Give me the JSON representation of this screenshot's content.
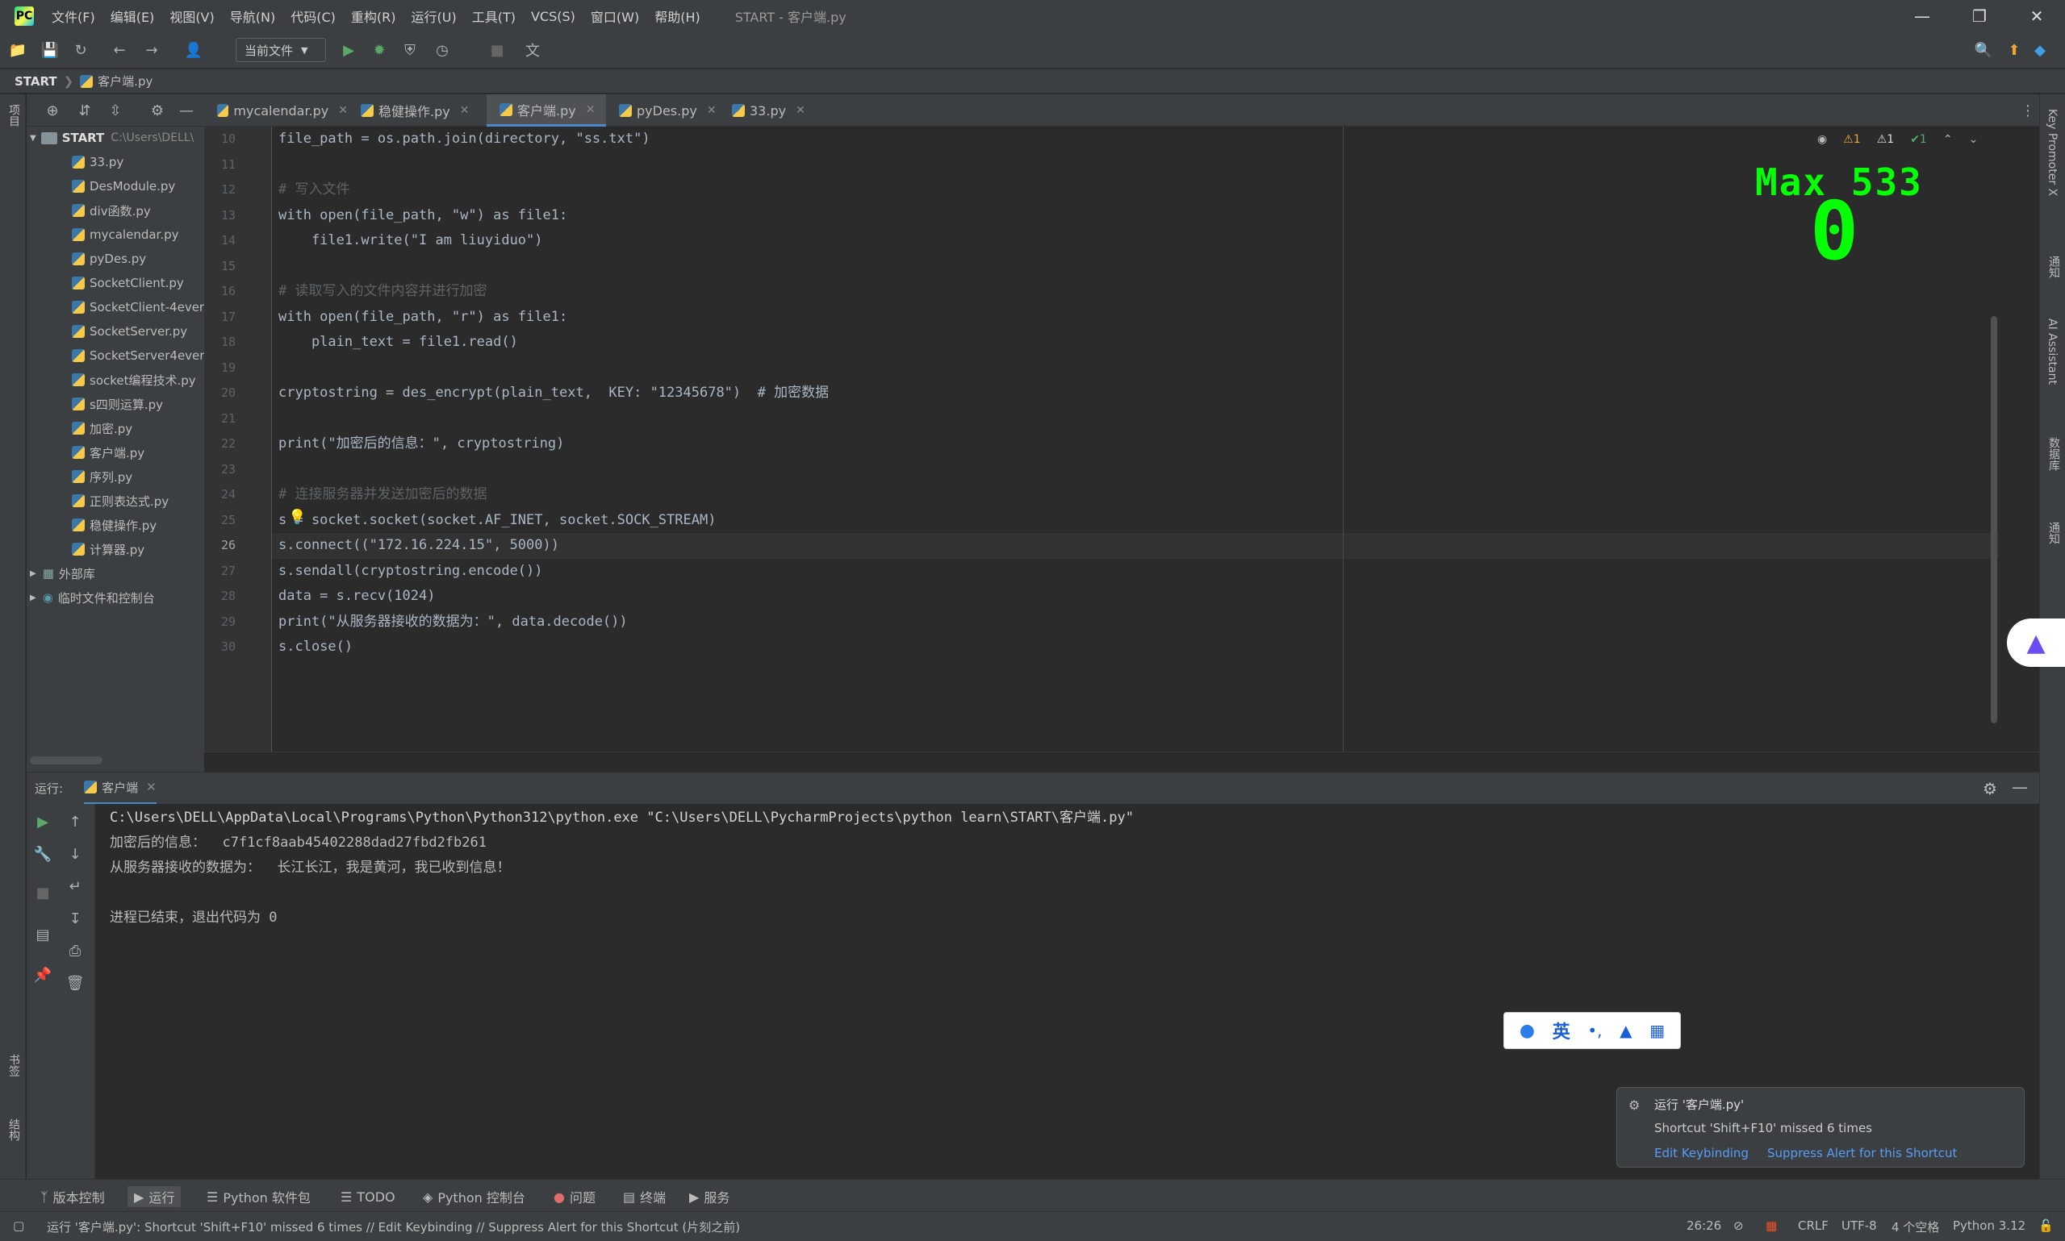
{
  "menu": {
    "items": [
      "文件(F)",
      "编辑(E)",
      "视图(V)",
      "导航(N)",
      "代码(C)",
      "重构(R)",
      "运行(U)",
      "工具(T)",
      "VCS(S)",
      "窗口(W)",
      "帮助(H)"
    ],
    "window_title": "START - 客户端.py",
    "logo": "PC"
  },
  "window_controls": {
    "minimize": "—",
    "restore": "❐",
    "close": "✕"
  },
  "toolbar": {
    "run_config": "当前文件"
  },
  "breadcrumb": {
    "root": "START",
    "file": "客户端.py"
  },
  "left_strip": {
    "project_label": "项目",
    "bookmarks_label": "书签",
    "structure_label": "结构"
  },
  "right_strip": {
    "key_promoter": "Key Promoter X",
    "notifications": "通知",
    "ai_assistant": "AI Assistant",
    "database": "数据库",
    "alerts": "通知"
  },
  "project_tree": {
    "root_name": "START",
    "root_path": "C:\\Users\\DELL\\",
    "files": [
      "33.py",
      "DesModule.py",
      "div函数.py",
      "mycalendar.py",
      "pyDes.py",
      "SocketClient.py",
      "SocketClient-4ever",
      "SocketServer.py",
      "SocketServer4ever",
      "socket编程技术.py",
      "s四则运算.py",
      "加密.py",
      "客户端.py",
      "序列.py",
      "正则表达式.py",
      "稳健操作.py",
      "计算器.py"
    ],
    "external_libs": "外部库",
    "scratches": "临时文件和控制台"
  },
  "tabs": [
    {
      "label": "mycalendar.py",
      "active": false
    },
    {
      "label": "稳健操作.py",
      "active": false
    },
    {
      "label": "客户端.py",
      "active": true
    },
    {
      "label": "pyDes.py",
      "active": false
    },
    {
      "label": "33.py",
      "active": false
    }
  ],
  "editor": {
    "caret_line": 26,
    "lines": [
      {
        "n": "10",
        "code": "file_path = os.path.join(directory, \"ss.txt\")"
      },
      {
        "n": "11",
        "code": ""
      },
      {
        "n": "12",
        "code": "# 写入文件"
      },
      {
        "n": "13",
        "code": "with open(file_path, \"w\") as file1:"
      },
      {
        "n": "14",
        "code": "    file1.write(\"I am liuyiduo\")"
      },
      {
        "n": "15",
        "code": ""
      },
      {
        "n": "16",
        "code": "# 读取写入的文件内容并进行加密"
      },
      {
        "n": "17",
        "code": "with open(file_path, \"r\") as file1:"
      },
      {
        "n": "18",
        "code": "    plain_text = file1.read()"
      },
      {
        "n": "19",
        "code": ""
      },
      {
        "n": "20",
        "code": "cryptostring = des_encrypt(plain_text,  KEY: \"12345678\")  # 加密数据"
      },
      {
        "n": "21",
        "code": ""
      },
      {
        "n": "22",
        "code": "print(\"加密后的信息：\", cryptostring)"
      },
      {
        "n": "23",
        "code": ""
      },
      {
        "n": "24",
        "code": "# 连接服务器并发送加密后的数据"
      },
      {
        "n": "25",
        "code": "s = socket.socket(socket.AF_INET, socket.SOCK_STREAM)"
      },
      {
        "n": "26",
        "code": "s.connect((\"172.16.224.15\", 5000))"
      },
      {
        "n": "27",
        "code": "s.sendall(cryptostring.encode())"
      },
      {
        "n": "28",
        "code": "data = s.recv(1024)"
      },
      {
        "n": "29",
        "code": "print(\"从服务器接收的数据为：\", data.decode())"
      },
      {
        "n": "30",
        "code": "s.close()"
      }
    ],
    "inspections": {
      "warn1": "1",
      "warn2": "1",
      "ok": "1"
    },
    "power_mode_max": "Max 533",
    "power_mode_combo": "0"
  },
  "run_panel": {
    "label": "运行:",
    "tab": "客户端",
    "output": [
      "C:\\Users\\DELL\\AppData\\Local\\Programs\\Python\\Python312\\python.exe \"C:\\Users\\DELL\\PycharmProjects\\python learn\\START\\客户端.py\"",
      "加密后的信息：  c7f1cf8aab45402288dad27fbd2fb261",
      "从服务器接收的数据为：  长江长江，我是黄河，我已收到信息！",
      "",
      "进程已结束，退出代码为 0"
    ]
  },
  "ime": {
    "lang": "英",
    "punct": "•,"
  },
  "notification": {
    "title": "运行 '客户端.py'",
    "body": "Shortcut 'Shift+F10' missed 6 times",
    "action1": "Edit Keybinding",
    "action2": "Suppress Alert for this Shortcut"
  },
  "bottom_tabs": [
    "版本控制",
    "运行",
    "Python 软件包",
    "TODO",
    "Python 控制台",
    "问题",
    "终端",
    "服务"
  ],
  "status": {
    "message": "运行 '客户端.py': Shortcut 'Shift+F10' missed 6 times // Edit Keybinding // Suppress Alert for this Shortcut (片刻之前)",
    "position": "26:26",
    "line_sep": "CRLF",
    "encoding": "UTF-8",
    "indent": "4 个空格",
    "interpreter": "Python 3.12"
  },
  "colors": {
    "accent": "#4a88c7",
    "power_mode": "#06ff06",
    "keyword": "#cc7832",
    "string": "#6a8759"
  }
}
